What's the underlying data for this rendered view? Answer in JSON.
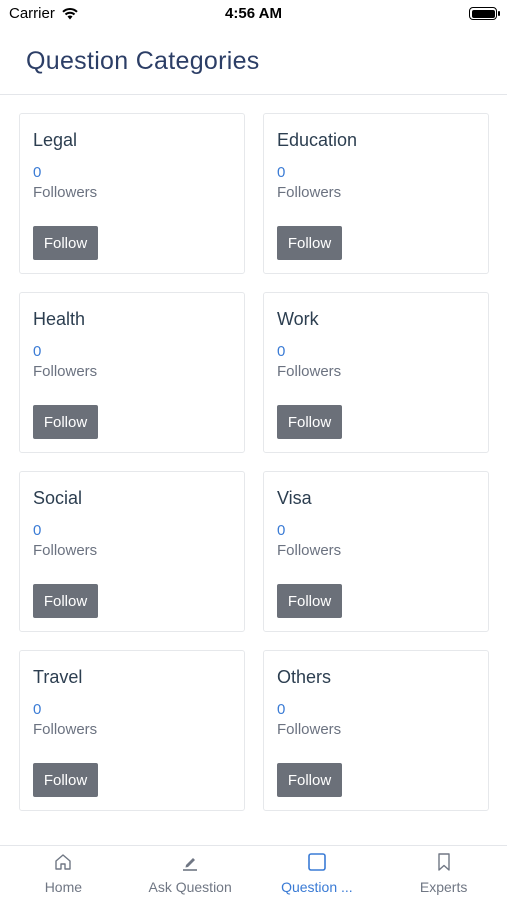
{
  "status_bar": {
    "carrier": "Carrier",
    "time": "4:56 AM"
  },
  "header": {
    "title": "Question Categories"
  },
  "categories": [
    {
      "name": "Legal",
      "count": "0",
      "followers_label": "Followers",
      "button_label": "Follow"
    },
    {
      "name": "Education",
      "count": "0",
      "followers_label": "Followers",
      "button_label": "Follow"
    },
    {
      "name": "Health",
      "count": "0",
      "followers_label": "Followers",
      "button_label": "Follow"
    },
    {
      "name": "Work",
      "count": "0",
      "followers_label": "Followers",
      "button_label": "Follow"
    },
    {
      "name": "Social",
      "count": "0",
      "followers_label": "Followers",
      "button_label": "Follow"
    },
    {
      "name": "Visa",
      "count": "0",
      "followers_label": "Followers",
      "button_label": "Follow"
    },
    {
      "name": "Travel",
      "count": "0",
      "followers_label": "Followers",
      "button_label": "Follow"
    },
    {
      "name": "Others",
      "count": "0",
      "followers_label": "Followers",
      "button_label": "Follow"
    }
  ],
  "tabs": [
    {
      "label": "Home",
      "icon": "home-icon",
      "active": false
    },
    {
      "label": "Ask Question",
      "icon": "pencil-icon",
      "active": false
    },
    {
      "label": "Question ...",
      "icon": "square-icon",
      "active": true
    },
    {
      "label": "Experts",
      "icon": "bookmark-icon",
      "active": false
    }
  ],
  "colors": {
    "accent": "#3a7bd5",
    "button": "#6b7079",
    "title": "#2c3e66"
  }
}
